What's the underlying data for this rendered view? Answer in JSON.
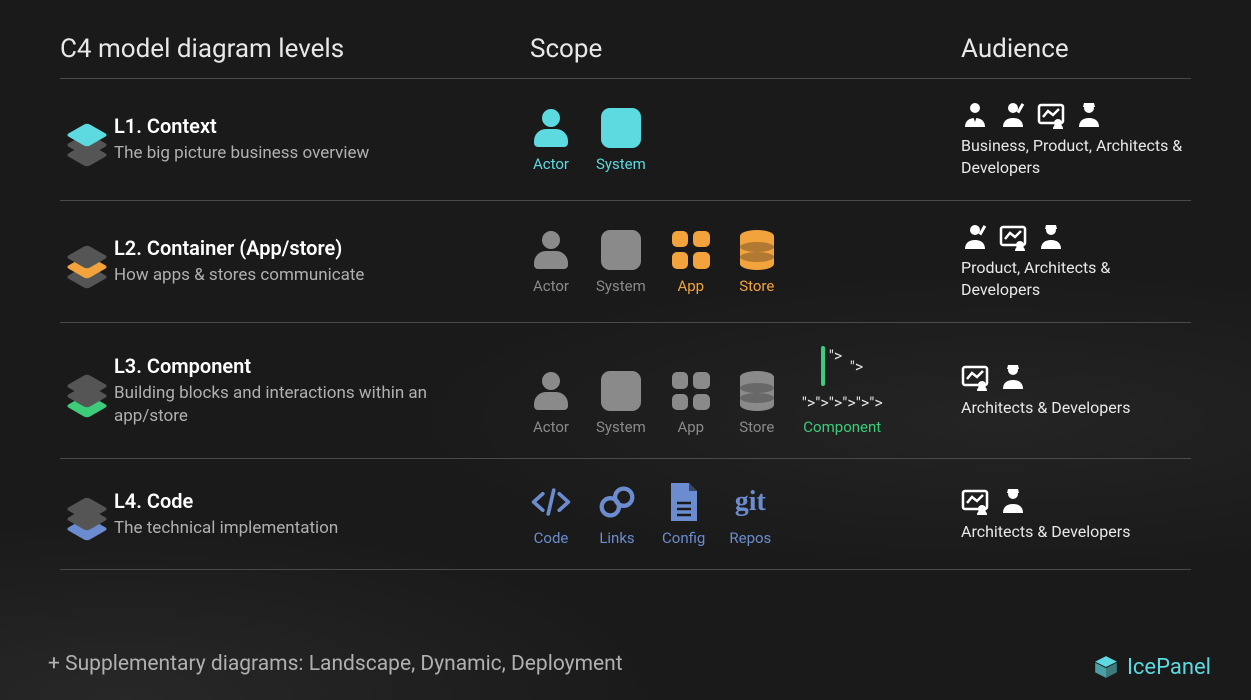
{
  "headers": {
    "levels": "C4 model diagram levels",
    "scope": "Scope",
    "audience": "Audience"
  },
  "rows": [
    {
      "title": "L1. Context",
      "sub": "The big picture business overview",
      "accent": "#5dd9e0",
      "scope": [
        {
          "id": "actor",
          "label": "Actor",
          "color": "#5dd9e0"
        },
        {
          "id": "system",
          "label": "System",
          "color": "#5dd9e0"
        }
      ],
      "audIcons": [
        "business",
        "product",
        "archboard",
        "dev"
      ],
      "audText": "Business, Product, Architects & Developers"
    },
    {
      "title": "L2. Container (App/store)",
      "sub": "How apps & stores communicate",
      "accent": "#f2a33c",
      "scope": [
        {
          "id": "actor",
          "label": "Actor",
          "color": "#8a8a8a"
        },
        {
          "id": "system",
          "label": "System",
          "color": "#8a8a8a"
        },
        {
          "id": "app",
          "label": "App",
          "color": "#f2a33c"
        },
        {
          "id": "store",
          "label": "Store",
          "color": "#f2a33c"
        }
      ],
      "audIcons": [
        "product",
        "archboard",
        "dev"
      ],
      "audText": "Product, Architects & Developers"
    },
    {
      "title": "L3. Component",
      "sub": "Building blocks and interactions within an app/store",
      "accent": "#3dcc7a",
      "scope": [
        {
          "id": "actor",
          "label": "Actor",
          "color": "#8a8a8a"
        },
        {
          "id": "system",
          "label": "System",
          "color": "#8a8a8a"
        },
        {
          "id": "app",
          "label": "App",
          "color": "#8a8a8a"
        },
        {
          "id": "store",
          "label": "Store",
          "color": "#8a8a8a"
        },
        {
          "id": "component",
          "label": "Component",
          "color": "#3dcc7a"
        }
      ],
      "audIcons": [
        "archboard",
        "dev"
      ],
      "audText": "Architects & Developers"
    },
    {
      "title": "L4. Code",
      "sub": "The technical implementation",
      "accent": "#6b8cce",
      "scope": [
        {
          "id": "code",
          "label": "Code",
          "color": "#6b8cce"
        },
        {
          "id": "links",
          "label": "Links",
          "color": "#6b8cce"
        },
        {
          "id": "config",
          "label": "Config",
          "color": "#6b8cce"
        },
        {
          "id": "repos",
          "label": "Repos",
          "color": "#6b8cce"
        }
      ],
      "audIcons": [
        "archboard",
        "dev"
      ],
      "audText": "Architects & Developers"
    }
  ],
  "supplementary": "+ Supplementary diagrams: Landscape, Dynamic, Deployment",
  "brand": "IcePanel"
}
